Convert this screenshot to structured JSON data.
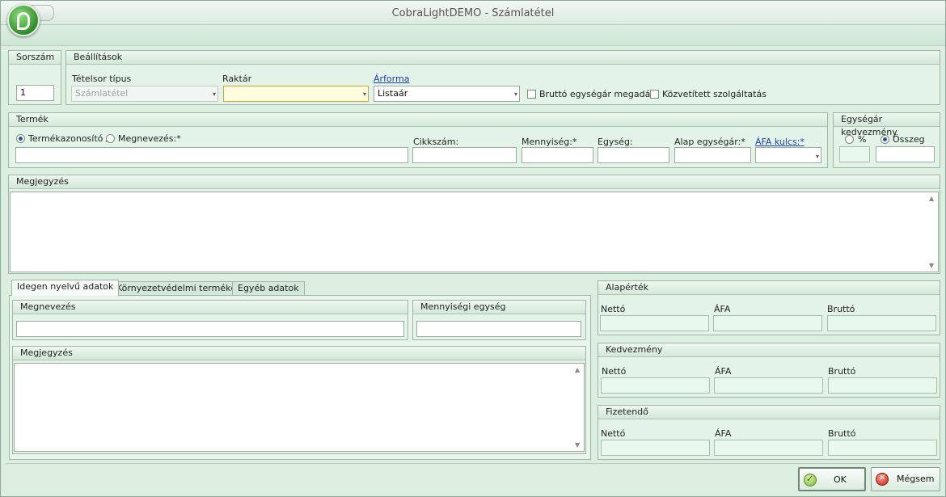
{
  "window": {
    "title": "CobraLightDEMO - Számlatétel"
  },
  "sorszam": {
    "header": "Sorszám",
    "value": "1"
  },
  "beallitasok": {
    "header": "Beállítások",
    "tetelsor_label": "Tételsor típus",
    "tetelsor_value": "Számlatétel",
    "raktar_label": "Raktár",
    "raktar_value": "",
    "arforma_label": "Árforma",
    "arforma_value": "Listaár",
    "brutto_label": "Bruttó egységár megadás",
    "brutto_checked": false,
    "kozvetitett_label": "Közvetített szolgáltatás",
    "kozvetitett_checked": false
  },
  "termek": {
    "header": "Termék",
    "radio_id_label": "Termékazonosító /",
    "radio_name_label": "Megnevezés:*",
    "selected": "Termékazonosító",
    "cikkszam_label": "Cikkszám:",
    "mennyiseg_label": "Mennyiség:*",
    "egyseg_label": "Egység:",
    "alap_label": "Alap egységár:*",
    "afa_label": "ÁFA kulcs:*"
  },
  "kedvezmeny": {
    "header": "Egységár kedvezmény",
    "pct_label": "%",
    "sum_label": "Összeg",
    "selected": "Összeg"
  },
  "megjegyzes": {
    "header": "Megjegyzés"
  },
  "tabs": [
    {
      "label": "Idegen nyelvű adatok",
      "active": true
    },
    {
      "label": "Környezetvédelmi termékdíj",
      "active": false
    },
    {
      "label": "Egyéb adatok",
      "active": false
    }
  ],
  "idegen": {
    "megnevezes_header": "Megnevezés",
    "mennyisegi_header": "Mennyiségi egység",
    "megjegyzes_header": "Megjegyzés"
  },
  "totals": [
    {
      "header": "Alapérték",
      "netto": "Nettó",
      "afa": "ÁFA",
      "brutto": "Bruttó"
    },
    {
      "header": "Kedvezmény",
      "netto": "Nettó",
      "afa": "ÁFA",
      "brutto": "Bruttó"
    },
    {
      "header": "Fizetendő",
      "netto": "Nettó",
      "afa": "ÁFA",
      "brutto": "Bruttó"
    }
  ],
  "buttons": {
    "ok": "OK",
    "cancel": "Mégsem"
  }
}
